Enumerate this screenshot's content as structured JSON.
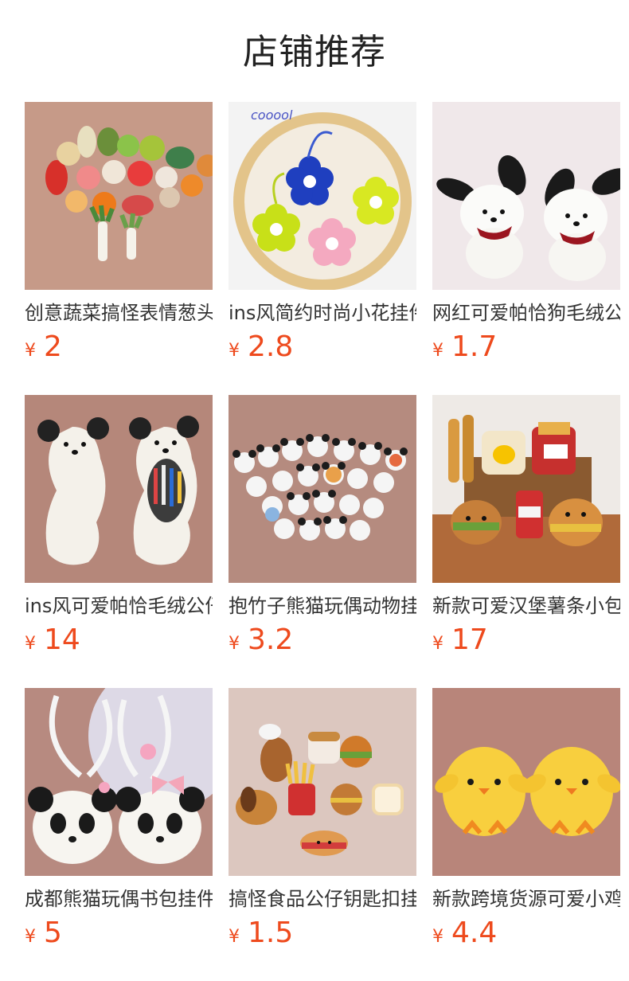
{
  "page": {
    "title": "店铺推荐"
  },
  "colors": {
    "price": "#ee4a1d",
    "title": "#222222",
    "text": "#333333"
  },
  "products": [
    {
      "name": "创意蔬菜搞怪表情葱头挂件",
      "currency": "¥",
      "price": "2",
      "image": "vegetable-plush-keychains"
    },
    {
      "name": "ins风简约时尚小花挂件",
      "currency": "¥",
      "price": "2.8",
      "image": "flower-keychains"
    },
    {
      "name": "网红可爱帕恰狗毛绒公仔",
      "currency": "¥",
      "price": "1.7",
      "image": "pochacco-plush"
    },
    {
      "name": "ins风可爱帕恰毛绒公仔笔袋",
      "currency": "¥",
      "price": "14",
      "image": "dog-pencil-case"
    },
    {
      "name": "抱竹子熊猫玩偶动物挂件",
      "currency": "¥",
      "price": "3.2",
      "image": "panda-plush-group"
    },
    {
      "name": "新款可爱汉堡薯条小包",
      "currency": "¥",
      "price": "17",
      "image": "burger-fries-bags"
    },
    {
      "name": "成都熊猫玩偶书包挂件",
      "currency": "¥",
      "price": "5",
      "image": "panda-bag-charms"
    },
    {
      "name": "搞怪食品公仔钥匙扣挂件",
      "currency": "¥",
      "price": "1.5",
      "image": "food-plush-keychains"
    },
    {
      "name": "新款跨境货源可爱小鸡公仔",
      "currency": "¥",
      "price": "4.4",
      "image": "yellow-chick-plush"
    }
  ]
}
